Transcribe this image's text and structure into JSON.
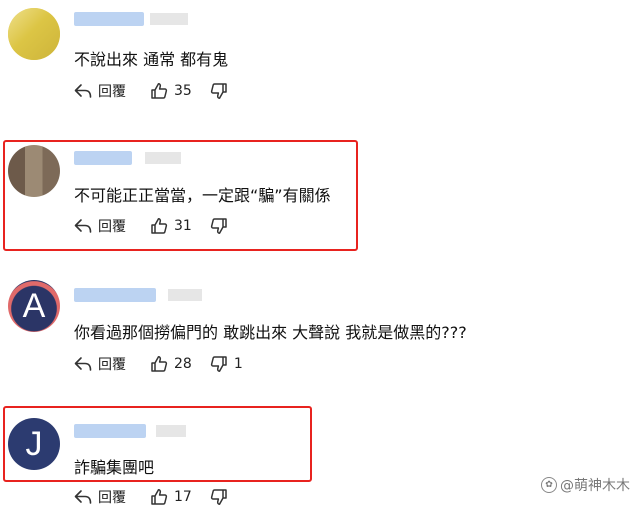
{
  "comments": [
    {
      "avatar_letter": "",
      "avatar_colors": [
        "#e8d36a",
        "#d9c24a"
      ],
      "text": "不說出來 通常 都有鬼",
      "reply_label": "回覆",
      "likes": "35",
      "dislikes": ""
    },
    {
      "avatar_letter": "",
      "avatar_colors": [
        "#7a6a5a",
        "#a89078"
      ],
      "text": "不可能正正當當，一定跟“騙”有關係",
      "reply_label": "回覆",
      "likes": "31",
      "dislikes": ""
    },
    {
      "avatar_letter": "A",
      "avatar_colors": [
        "#2b3566",
        "#e05a5a"
      ],
      "text": "你看過那個撈偏門的 敢跳出來 大聲說 我就是做黑的???",
      "reply_label": "回覆",
      "likes": "28",
      "dislikes": "1"
    },
    {
      "avatar_letter": "J",
      "avatar_colors": [
        "#2c3b70",
        "#2c3b70"
      ],
      "text": "詐騙集團吧",
      "reply_label": "回覆",
      "likes": "17",
      "dislikes": ""
    }
  ],
  "watermark": "@萌神木木",
  "colors": {
    "highlight": "#e8231f",
    "name_blur": "#bcd3f2",
    "time_blur": "#e4e4e4"
  }
}
